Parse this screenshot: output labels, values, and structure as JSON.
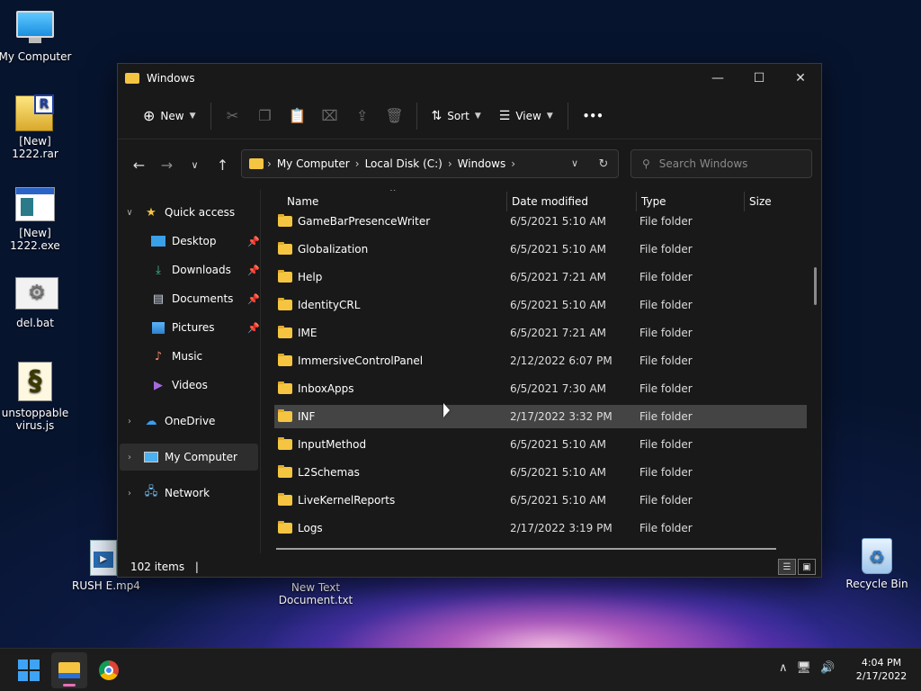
{
  "desktop": {
    "icons": [
      {
        "label": "My Computer"
      },
      {
        "label": "[New]\n1222.rar"
      },
      {
        "label": "[New]\n1222.exe"
      },
      {
        "label": "del.bat"
      },
      {
        "label": "unstoppable\nvirus.js"
      },
      {
        "label": "RUSH E.mp4"
      },
      {
        "label": "New Text\nDocument.txt"
      },
      {
        "label": "Recycle Bin"
      }
    ]
  },
  "window": {
    "title": "Windows",
    "toolbar": {
      "new_label": "New",
      "sort_label": "Sort",
      "view_label": "View",
      "more_label": "•••"
    },
    "breadcrumb": [
      "My Computer",
      "Local Disk (C:)",
      "Windows"
    ],
    "search_placeholder": "Search Windows",
    "sidebar": [
      {
        "label": "Quick access"
      },
      {
        "label": "Desktop"
      },
      {
        "label": "Downloads"
      },
      {
        "label": "Documents"
      },
      {
        "label": "Pictures"
      },
      {
        "label": "Music"
      },
      {
        "label": "Videos"
      },
      {
        "label": "OneDrive"
      },
      {
        "label": "My Computer"
      },
      {
        "label": "Network"
      }
    ],
    "columns": {
      "name": "Name",
      "date": "Date modified",
      "type": "Type",
      "size": "Size"
    },
    "files": [
      {
        "name": "GameBarPresenceWriter",
        "date": "6/5/2021 5:10 AM",
        "type": "File folder"
      },
      {
        "name": "Globalization",
        "date": "6/5/2021 5:10 AM",
        "type": "File folder"
      },
      {
        "name": "Help",
        "date": "6/5/2021 7:21 AM",
        "type": "File folder"
      },
      {
        "name": "IdentityCRL",
        "date": "6/5/2021 5:10 AM",
        "type": "File folder"
      },
      {
        "name": "IME",
        "date": "6/5/2021 7:21 AM",
        "type": "File folder"
      },
      {
        "name": "ImmersiveControlPanel",
        "date": "2/12/2022 6:07 PM",
        "type": "File folder"
      },
      {
        "name": "InboxApps",
        "date": "6/5/2021 7:30 AM",
        "type": "File folder"
      },
      {
        "name": "INF",
        "date": "2/17/2022 3:32 PM",
        "type": "File folder"
      },
      {
        "name": "InputMethod",
        "date": "6/5/2021 5:10 AM",
        "type": "File folder"
      },
      {
        "name": "L2Schemas",
        "date": "6/5/2021 5:10 AM",
        "type": "File folder"
      },
      {
        "name": "LiveKernelReports",
        "date": "6/5/2021 5:10 AM",
        "type": "File folder"
      },
      {
        "name": "Logs",
        "date": "2/17/2022 3:19 PM",
        "type": "File folder"
      }
    ],
    "status": "102 items"
  },
  "taskbar": {
    "time": "4:04 PM",
    "date": "2/17/2022"
  }
}
